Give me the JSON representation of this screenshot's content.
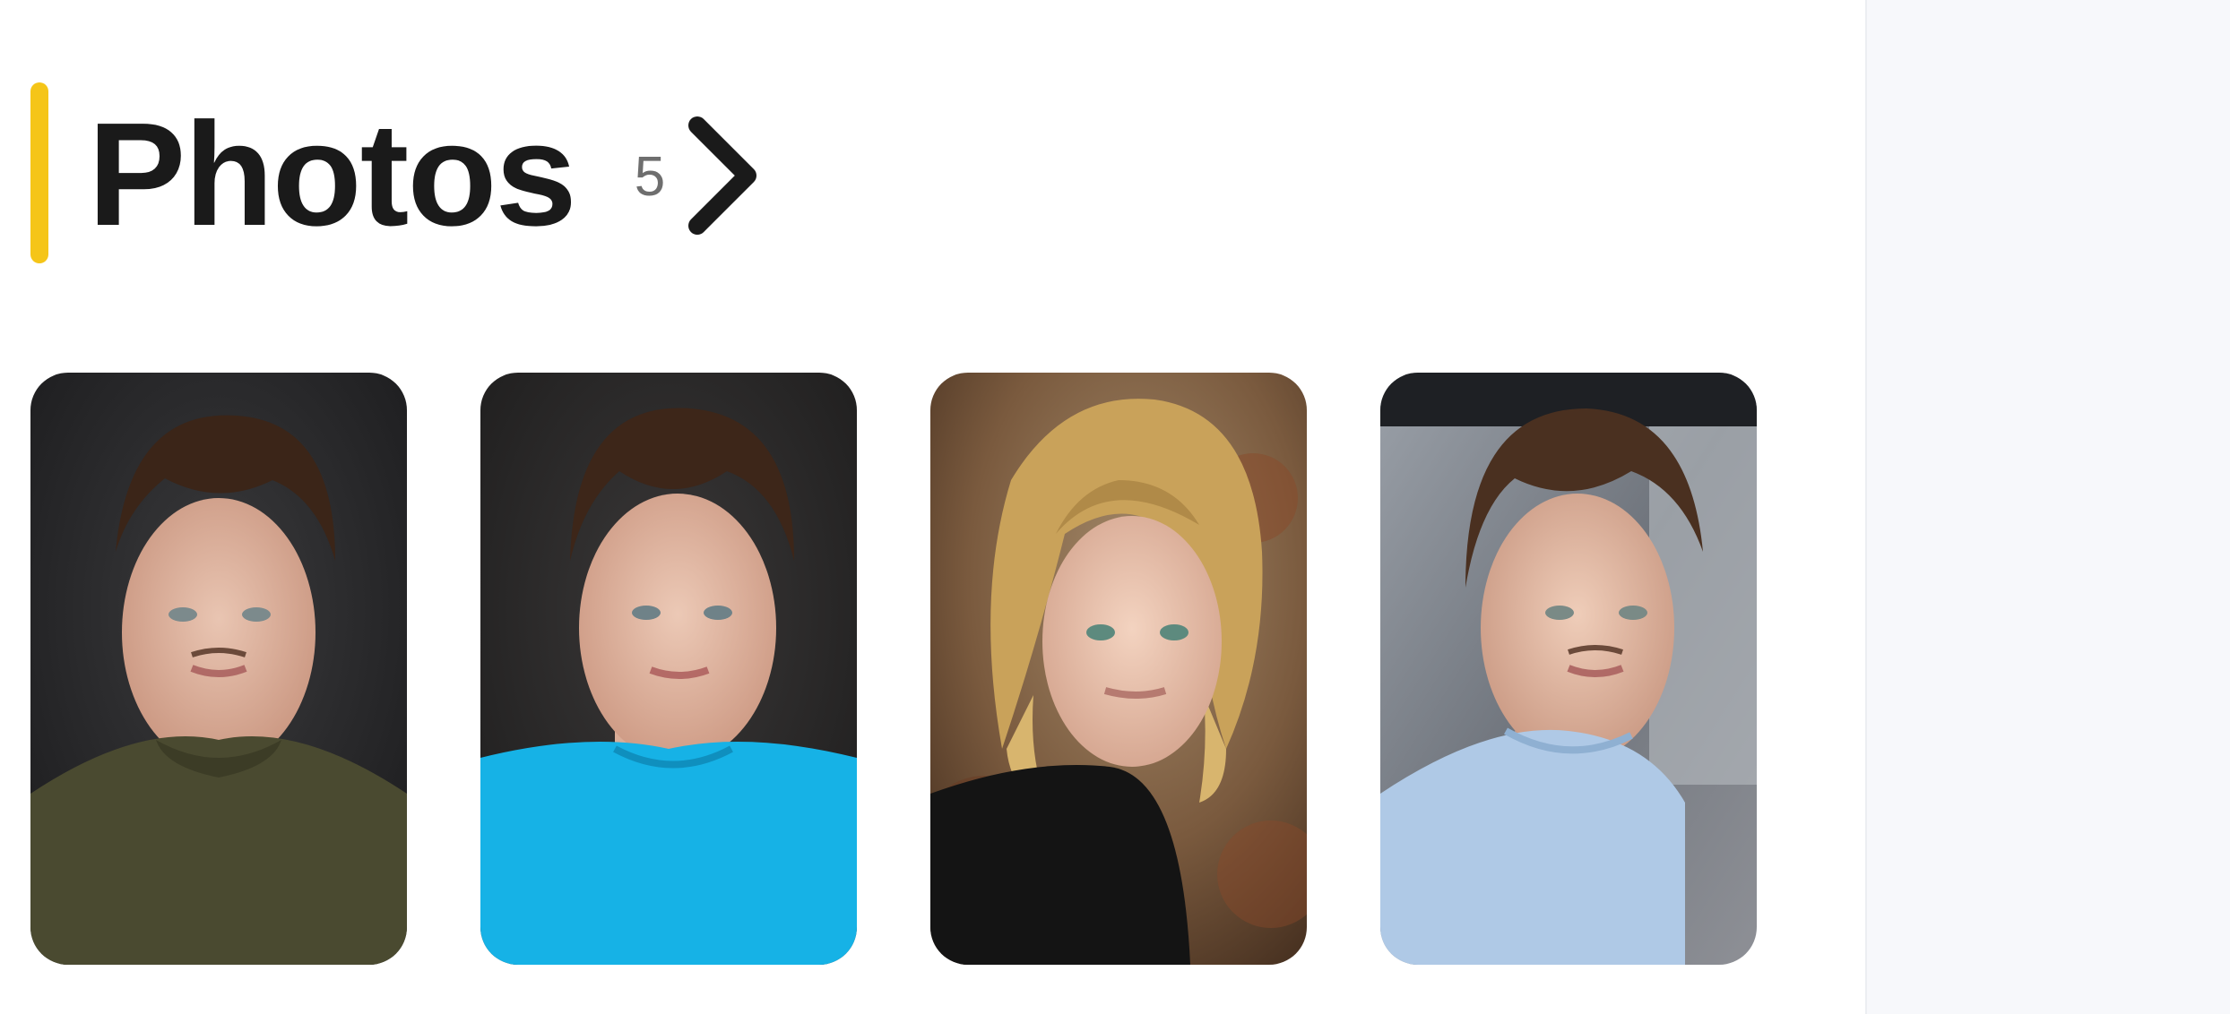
{
  "section": {
    "title": "Photos",
    "count": "5"
  },
  "colors": {
    "accent": "#f5c518",
    "title": "#1a1a1a",
    "count": "#6e6e6e",
    "side_panel_bg": "#f7f8fb"
  },
  "icons": {
    "see_all": "chevron-right-icon"
  },
  "photos": [
    {
      "subject": "portrait-dark-background-olive-sweater"
    },
    {
      "subject": "portrait-dark-background-blue-tshirt"
    },
    {
      "subject": "portrait-rust-background-blond-hair-black-knit"
    },
    {
      "subject": "portrait-outdoor-light-blue-sweater"
    }
  ]
}
